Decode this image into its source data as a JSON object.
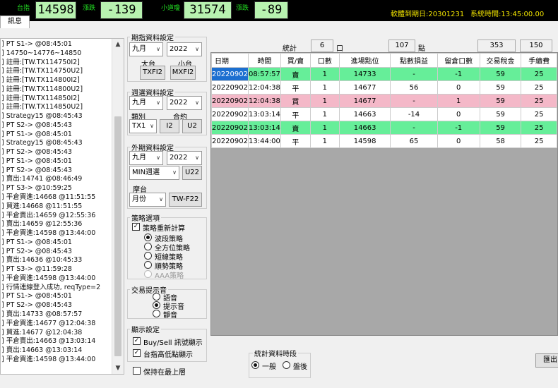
{
  "topbar": {
    "label1": "台指",
    "value1": "14598",
    "label2": "漲跌",
    "value2": "-139",
    "label3": "小道瓊",
    "value3": "31574",
    "label4": "漲跌",
    "value4": "-89",
    "expiry": "軟體到期日:20301231",
    "systime": "系統時間:13:45:00.00",
    "accent_color": "#22dd22",
    "box_color": "#b8f2b0"
  },
  "tab": {
    "label": "訊息"
  },
  "log": {
    "lines": [
      "] PT S1-> @08:45:01",
      "] 14750~14776~14850",
      "] 註冊:[TW.TX114750I2]",
      "] 註冊:[TW.TX114750U2]",
      "] 註冊:[TW.TX114800I2]",
      "] 註冊:[TW.TX114800U2]",
      "] 註冊:[TW.TX114850I2]",
      "] 註冊:[TW.TX114850U2]",
      "] Strategy15 @08:45:43",
      "] PT S2-> @08:45:43",
      "] PT S1-> @08:45:01",
      "] Strategy15 @08:45:43",
      "] PT S2-> @08:45:43",
      "] PT S1-> @08:45:01",
      "] PT S2-> @08:45:43",
      "] 賣出:14741 @08:46:49",
      "] PT S3-> @10:59:25",
      "] 平倉買進:14668 @11:51:55",
      "] 買進:14668 @11:51:55",
      "] 平倉賣出:14659 @12:55:36",
      "] 賣出:14659 @12:55:36",
      "] 平倉買進:14598 @13:44:00",
      "] PT S1-> @08:45:01",
      "] PT S2-> @08:45:43",
      "] 賣出:14636 @10:45:33",
      "] PT S3-> @11:59:28",
      "] 平倉買進:14598 @13:44:00",
      "] 行情連線登入成功, reqType=2",
      "] PT S1-> @08:45:01",
      "] PT S2-> @08:45:43",
      "] 賣出:14733 @08:57:57",
      "] 平倉買進:14677 @12:04:38",
      "] 買進:14677 @12:04:38",
      "] 平倉賣出:14663 @13:03:14",
      "] 賣出:14663 @13:03:14",
      "] 平倉買進:14598 @13:44:00"
    ]
  },
  "futures": {
    "title": "期指資料設定",
    "month": "九月",
    "year": "2022",
    "big_label": "大台",
    "small_label": "小台",
    "big_btn": "TXFI2",
    "small_btn": "MXFI2"
  },
  "weekly": {
    "title": "週選資料設定",
    "month": "九月",
    "year": "2022",
    "category_label": "類別",
    "contract_label": "合約",
    "category": "TX1",
    "btn1": "I2",
    "btn2": "U2"
  },
  "foreign": {
    "title": "外期資料設定",
    "month": "九月",
    "year": "2022",
    "interval": "MIN週選",
    "btn": "U22",
    "mt_label": "摩台",
    "mt_select": "月份",
    "mt_btn": "TW-F22"
  },
  "strategy": {
    "title": "策略選項",
    "recalc_label": "策略重新計算",
    "recalc_checked": true,
    "options": [
      {
        "label": "波段策略",
        "selected": true,
        "disabled": false
      },
      {
        "label": "全方位策略",
        "selected": false,
        "disabled": false
      },
      {
        "label": "短線策略",
        "selected": false,
        "disabled": false
      },
      {
        "label": "順勢策略",
        "selected": false,
        "disabled": false
      },
      {
        "label": "AAA策略",
        "selected": false,
        "disabled": true
      }
    ]
  },
  "sound": {
    "title": "交易提示音",
    "options": [
      {
        "label": "語音",
        "selected": false
      },
      {
        "label": "提示音",
        "selected": true
      },
      {
        "label": "靜音",
        "selected": false
      }
    ]
  },
  "display": {
    "title": "顯示設定",
    "opt1": "Buy/Sell 訊號顯示",
    "opt1_checked": true,
    "opt2": "台指高低點顯示",
    "opt2_checked": true,
    "ontop": "保持在最上層",
    "ontop_checked": false
  },
  "summary": {
    "label": "統計",
    "lots": "6",
    "lots_unit": "口",
    "points": "107",
    "points_unit": "點",
    "tax": "353",
    "fee": "150"
  },
  "table": {
    "headers": [
      "日期",
      "時間",
      "買/賣",
      "口數",
      "進場點位",
      "點數損益",
      "留倉口數",
      "交易稅金",
      "手續費"
    ],
    "rows": [
      {
        "style": "green",
        "cells": [
          "20220902",
          "08:57:57",
          "賣",
          "1",
          "14733",
          "-",
          "-1",
          "59",
          "25"
        ]
      },
      {
        "style": "white",
        "cells": [
          "20220902",
          "12:04:38",
          "平",
          "1",
          "14677",
          "56",
          "0",
          "59",
          "25"
        ]
      },
      {
        "style": "pink",
        "cells": [
          "20220902",
          "12:04:38",
          "買",
          "1",
          "14677",
          "-",
          "1",
          "59",
          "25"
        ]
      },
      {
        "style": "white",
        "cells": [
          "20220902",
          "13:03:14",
          "平",
          "1",
          "14663",
          "-14",
          "0",
          "59",
          "25"
        ]
      },
      {
        "style": "green",
        "cells": [
          "20220902",
          "13:03:14",
          "賣",
          "1",
          "14663",
          "-",
          "-1",
          "59",
          "25"
        ]
      },
      {
        "style": "white",
        "cells": [
          "20220902",
          "13:44:00",
          "平",
          "1",
          "14598",
          "65",
          "0",
          "58",
          "25"
        ]
      }
    ]
  },
  "period": {
    "title": "統計資料時段",
    "normal": "一般",
    "normal_selected": true,
    "after": "盤後",
    "after_selected": false
  },
  "bottom_button": "匯出"
}
